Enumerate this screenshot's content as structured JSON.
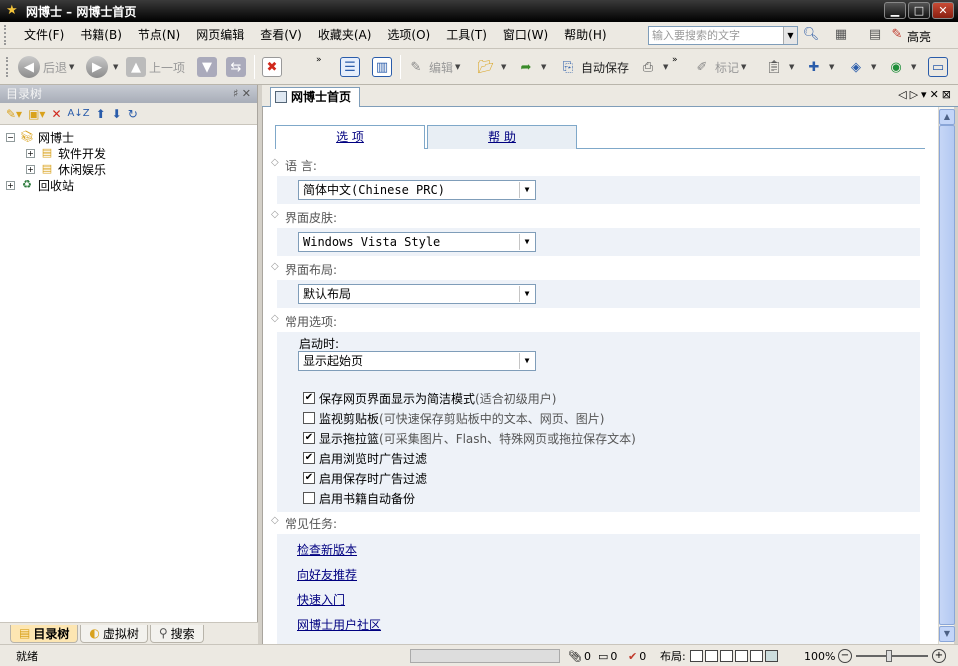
{
  "window": {
    "title": "网博士 – 网博士首页"
  },
  "menubar": {
    "items": [
      "文件(F)",
      "书籍(B)",
      "节点(N)",
      "网页编辑",
      "查看(V)",
      "收藏夹(A)",
      "选项(O)",
      "工具(T)",
      "窗口(W)",
      "帮助(H)"
    ],
    "search_placeholder": "输入要搜索的文字",
    "highlight_label": "高亮"
  },
  "toolbar": {
    "back": "后退",
    "prev": "上一项",
    "edit": "编辑",
    "autosave": "自动保存",
    "mark": "标记"
  },
  "leftpanel": {
    "title": "目录树",
    "pin": "♯ ✕",
    "tree": [
      {
        "label": "网博士",
        "level": 0,
        "expanded": true
      },
      {
        "label": "软件开发",
        "level": 1
      },
      {
        "label": "休闲娱乐",
        "level": 1
      },
      {
        "label": "回收站",
        "level": 0
      }
    ],
    "tabs": [
      "目录树",
      "虚拟树",
      "搜索"
    ]
  },
  "doctab": {
    "label": "网博士首页"
  },
  "options": {
    "tab_options": "选 项",
    "tab_help": "帮 助",
    "lang_label": "语 言:",
    "lang_value": "简体中文(Chinese PRC)",
    "skin_label": "界面皮肤:",
    "skin_value": "Windows Vista Style",
    "layout_label": "界面布局:",
    "layout_value": "默认布局",
    "common_label": "常用选项:",
    "startup_label": "启动时:",
    "startup_value": "显示起始页",
    "checks": [
      {
        "label": "保存网页界面显示为简洁模式",
        "note": "(适合初级用户)",
        "checked": true
      },
      {
        "label": "监视剪贴板",
        "note": "(可快速保存剪贴板中的文本、网页、图片)",
        "checked": false
      },
      {
        "label": "显示拖拉篮",
        "note": "(可采集图片、Flash、特殊网页或拖拉保存文本)",
        "checked": true
      },
      {
        "label": "启用浏览时广告过滤",
        "note": "",
        "checked": true
      },
      {
        "label": "启用保存时广告过滤",
        "note": "",
        "checked": true
      },
      {
        "label": "启用书籍自动备份",
        "note": "",
        "checked": false
      }
    ],
    "tasks_label": "常见任务:",
    "tasks": [
      "检查新版本",
      "向好友推荐",
      "快速入门",
      "网博士用户社区"
    ]
  },
  "statusbar": {
    "ready": "就绪",
    "c1": "0",
    "c2": "0",
    "c3": "0",
    "layout_label": "布局:",
    "zoom": "100%"
  }
}
